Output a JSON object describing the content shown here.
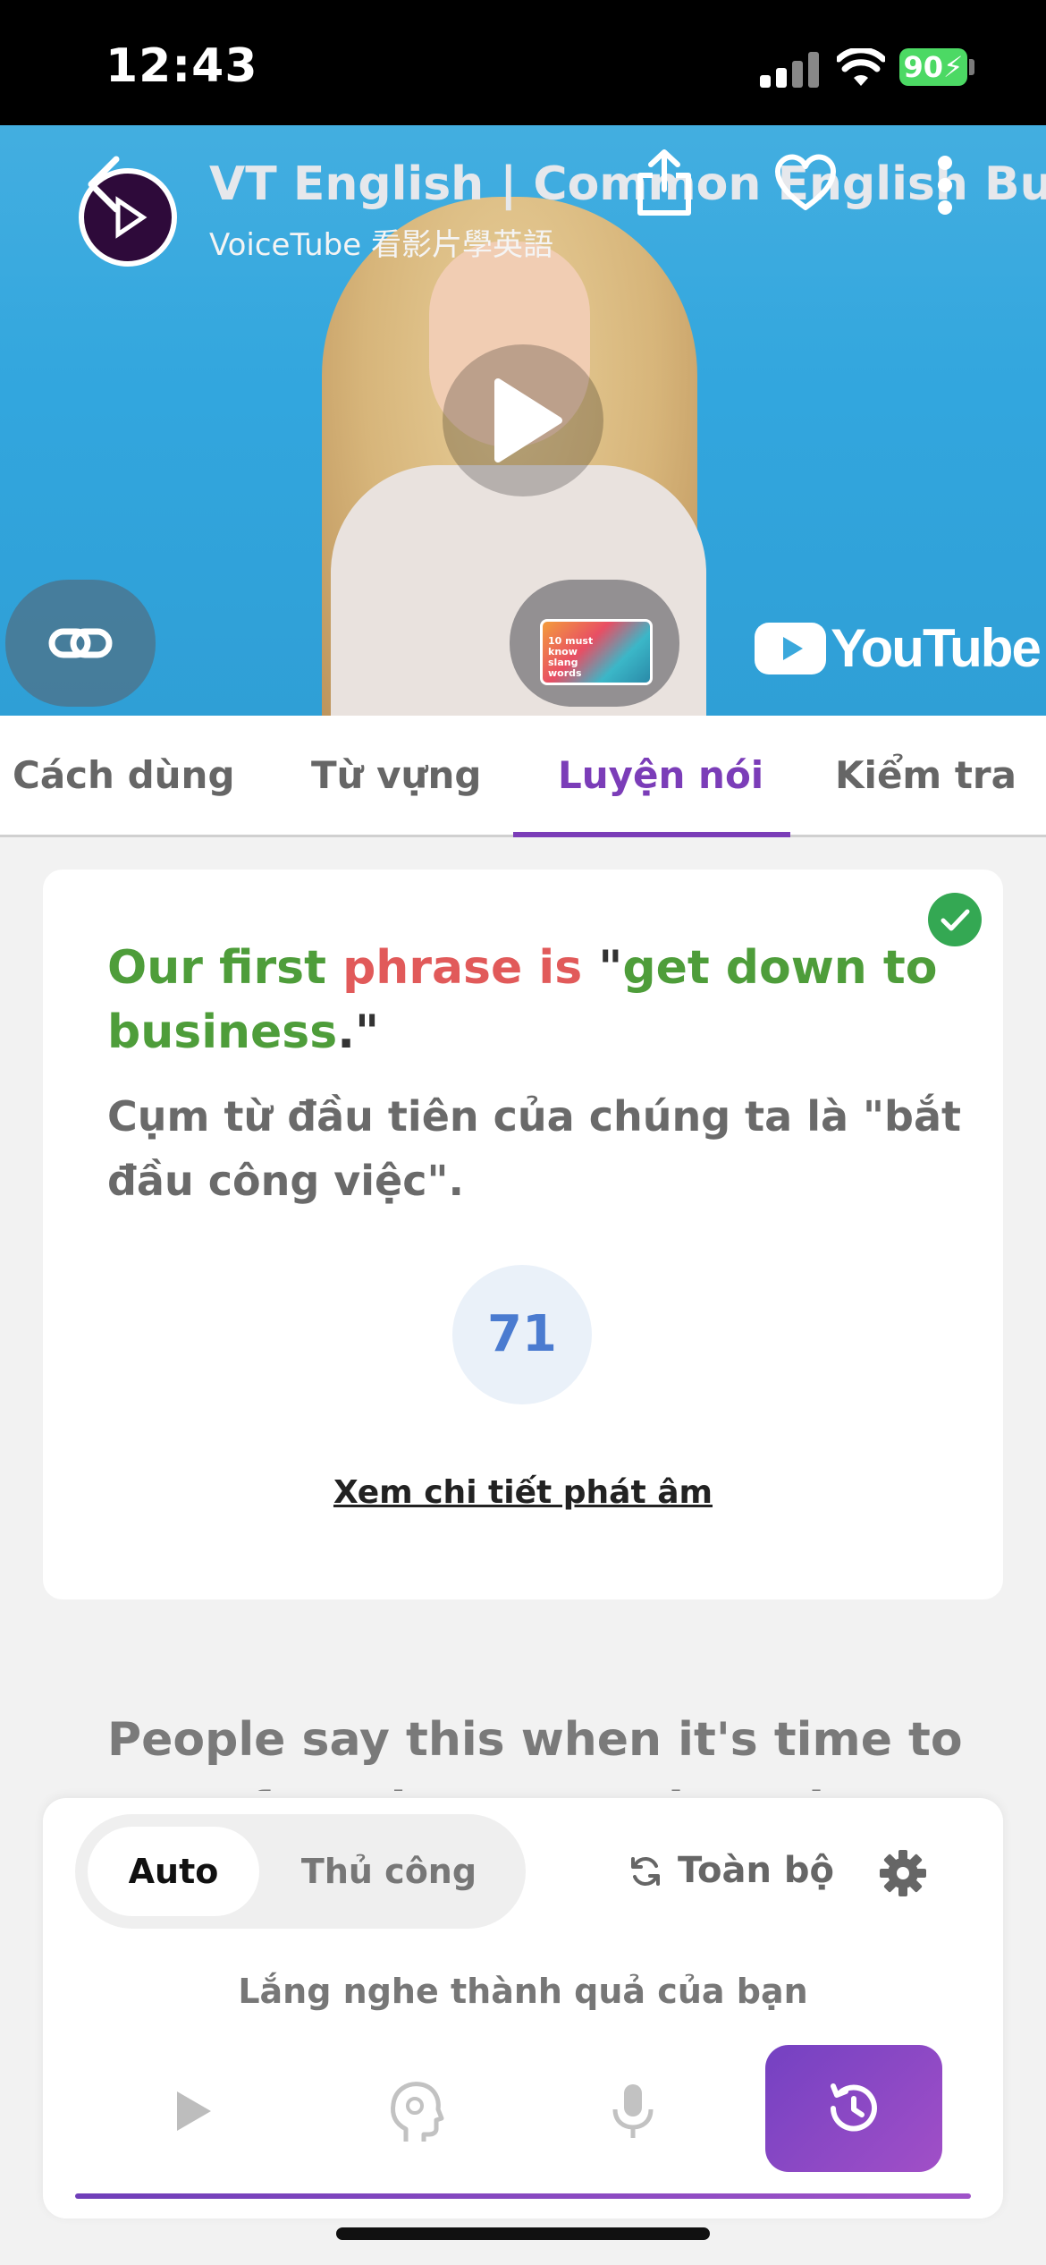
{
  "status_bar": {
    "time": "12:43",
    "battery": "90"
  },
  "video": {
    "title": "VT English | Common English Bus",
    "channel": "VoiceTube 看影片學英語",
    "thumbnail_text": "10 must know slang words",
    "platform_logo": "YouTube"
  },
  "tabs": [
    {
      "label": "Cách dùng"
    },
    {
      "label": "Từ vựng"
    },
    {
      "label": "Luyện nói"
    },
    {
      "label": "Kiểm tra"
    }
  ],
  "card": {
    "phrase_parts": [
      "Our first ",
      "phrase is",
      " \"",
      "get down to business",
      ".\""
    ],
    "translation": "Cụm từ đầu tiên của chúng ta là \"bắt đầu công việc\".",
    "score": "71",
    "detail_link": "Xem chi tiết phát âm"
  },
  "explanation": "People say this when it's time to start focusing on work or the",
  "panel": {
    "mode_auto": "Auto",
    "mode_manual": "Thủ công",
    "repeat_label": "Toàn bộ",
    "hint": "Lắng nghe thành quả của bạn"
  },
  "colors": {
    "accent": "#7b3db8",
    "correct": "#4e9d3a",
    "wrong": "#e15a5a",
    "score": "#4a7bd0"
  }
}
